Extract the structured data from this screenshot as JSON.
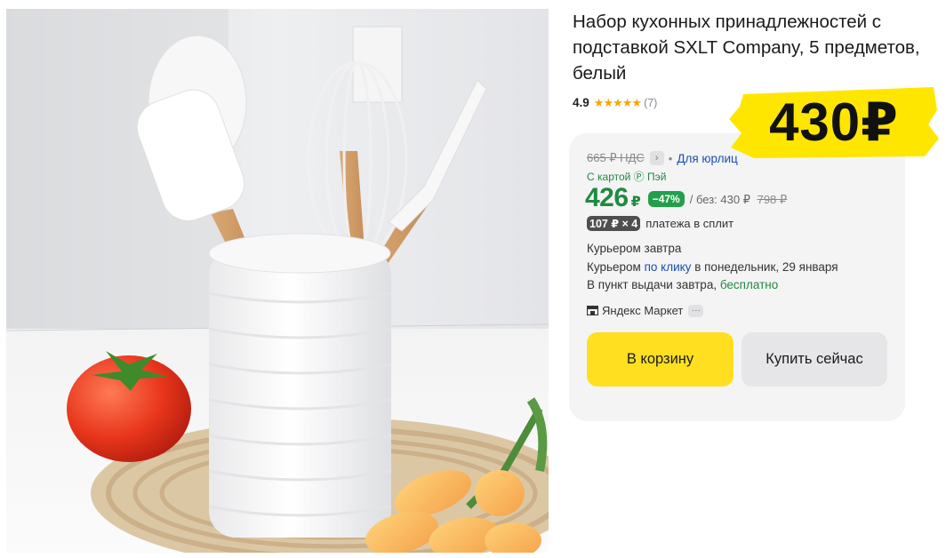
{
  "product": {
    "title": "Набор кухонных принадлежностей с подставкой SXLT Company, 5 предметов, белый",
    "rating": "4.9",
    "reviews": "(7)",
    "stars_filled": 5
  },
  "sticker": {
    "price": "430₽",
    "color": "#ffe600"
  },
  "buy_card": {
    "vat_price": "665 ₽ НДС",
    "chevron": "›",
    "dot": "•",
    "legal_link": "Для юрлиц",
    "card_note": "С картой Ⓟ Пэй",
    "price": "426",
    "currency": "₽",
    "discount": "−47%",
    "without_label": "/ без: 430 ₽",
    "old_price": "798 ₽",
    "split_pill": "107 ₽ × 4",
    "split_label": "платежа в сплит",
    "delivery": {
      "line1": "Курьером завтра",
      "line2_prefix": "Курьером",
      "line2_link": "по клику",
      "line2_suffix": "в понедельник, 29 января",
      "line3_prefix": "В пункт выдачи завтра,",
      "line3_free": "бесплатно"
    },
    "seller": "Яндекс Маркет",
    "seller_more": "···",
    "cart_button": "В корзину",
    "buy_button": "Купить сейчас"
  },
  "colors": {
    "accent_yellow": "#ffdf1f",
    "price_green": "#1f8a3f",
    "discount_green": "#21a049",
    "link_blue": "#1a4fb4"
  }
}
